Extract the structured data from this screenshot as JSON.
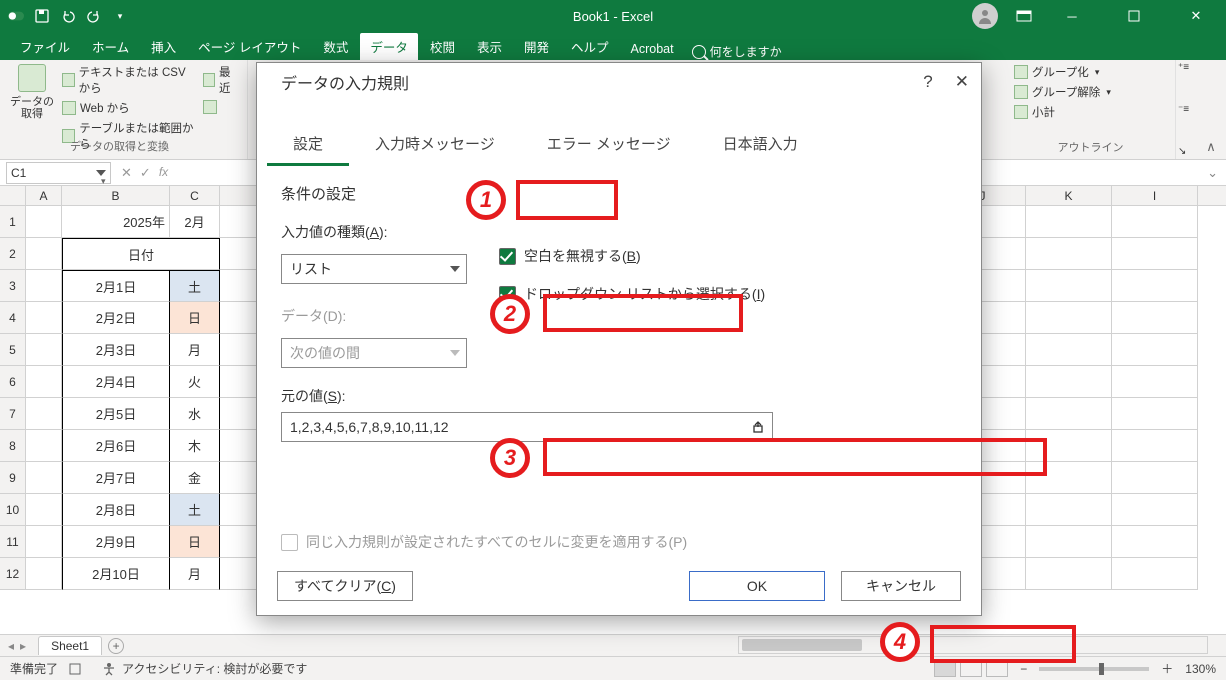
{
  "title": "Book1 - Excel",
  "qat": {
    "autosave": "off"
  },
  "tabs": [
    "ファイル",
    "ホーム",
    "挿入",
    "ページ レイアウト",
    "数式",
    "データ",
    "校閲",
    "表示",
    "開発",
    "ヘルプ",
    "Acrobat"
  ],
  "tabs_active_index": 5,
  "tell_me": "何をしますか",
  "ribbon": {
    "get_data": "データの\n取得",
    "items": [
      "テキストまたは CSV から",
      "Web から",
      "テーブルまたは範囲から"
    ],
    "recent": "最近",
    "group1": "データの取得と変換",
    "right_items": [
      "グループ化",
      "グループ解除",
      "小計"
    ],
    "outline_group": "アウトライン"
  },
  "namebox": "C1",
  "columns": [
    "A",
    "B",
    "C",
    "J",
    "K",
    "I"
  ],
  "sheet_cells": {
    "B1": "2025年",
    "C1": "2月",
    "B2": "日付",
    "rows": [
      {
        "r": 3,
        "b": "2月1日",
        "c": "土",
        "cls": "day-sat"
      },
      {
        "r": 4,
        "b": "2月2日",
        "c": "日",
        "cls": "day-sun"
      },
      {
        "r": 5,
        "b": "2月3日",
        "c": "月",
        "cls": ""
      },
      {
        "r": 6,
        "b": "2月4日",
        "c": "火",
        "cls": ""
      },
      {
        "r": 7,
        "b": "2月5日",
        "c": "水",
        "cls": ""
      },
      {
        "r": 8,
        "b": "2月6日",
        "c": "木",
        "cls": ""
      },
      {
        "r": 9,
        "b": "2月7日",
        "c": "金",
        "cls": ""
      },
      {
        "r": 10,
        "b": "2月8日",
        "c": "土",
        "cls": "day-sat"
      },
      {
        "r": 11,
        "b": "2月9日",
        "c": "日",
        "cls": "day-sun"
      },
      {
        "r": 12,
        "b": "2月10日",
        "c": "月",
        "cls": ""
      }
    ]
  },
  "dialog": {
    "title": "データの入力規則",
    "help": "?",
    "tabs": [
      "設定",
      "入力時メッセージ",
      "エラー メッセージ",
      "日本語入力"
    ],
    "active_tab": 0,
    "section": "条件の設定",
    "allow_label_pre": "入力値の種類(",
    "allow_accel": "A",
    "allow_label_post": "):",
    "allow_value": "リスト",
    "data_label": "データ(D):",
    "data_value": "次の値の間",
    "ignore_blank_pre": "空白を無視する(",
    "ignore_blank_accel": "B",
    "ignore_blank_post": ")",
    "dropdown_pre": "ドロップダウン リストから選択する(",
    "dropdown_accel": "I",
    "dropdown_post": ")",
    "source_label_pre": "元の値(",
    "source_accel": "S",
    "source_label_post": "):",
    "source_value": "1,2,3,4,5,6,7,8,9,10,11,12",
    "apply_all": "同じ入力規則が設定されたすべてのセルに変更を適用する(P)",
    "clear_pre": "すべてクリア(",
    "clear_accel": "C",
    "clear_post": ")",
    "ok": "OK",
    "cancel": "キャンセル"
  },
  "sheet_tab": "Sheet1",
  "status": {
    "ready": "準備完了",
    "accessibility": "アクセシビリティ: 検討が必要です",
    "zoom": "130%"
  },
  "callouts": {
    "n1": "1",
    "n2": "2",
    "n3": "3",
    "n4": "4"
  }
}
